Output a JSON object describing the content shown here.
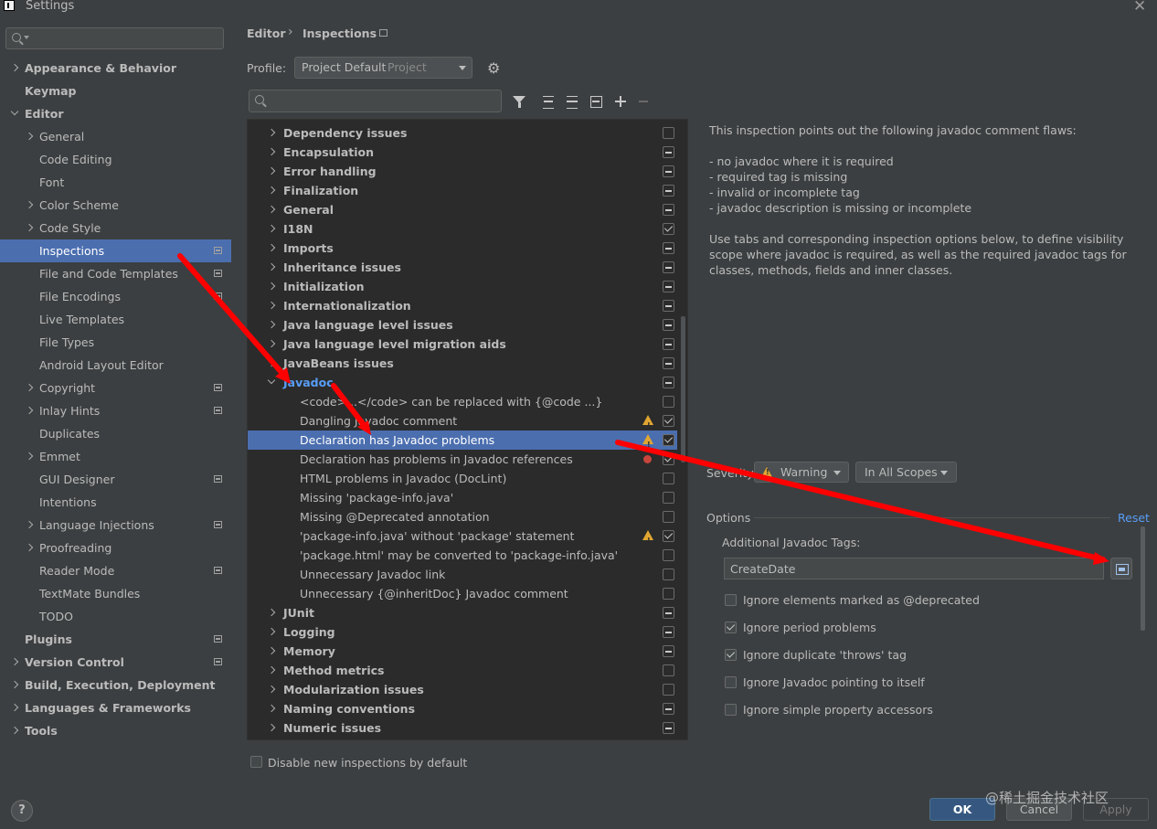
{
  "window": {
    "title": "Settings"
  },
  "sidebar": {
    "search_placeholder": "",
    "items": [
      {
        "label": "Appearance & Behavior"
      },
      {
        "label": "Keymap"
      },
      {
        "label": "Editor"
      },
      {
        "label": "General"
      },
      {
        "label": "Code Editing"
      },
      {
        "label": "Font"
      },
      {
        "label": "Color Scheme"
      },
      {
        "label": "Code Style"
      },
      {
        "label": "Inspections"
      },
      {
        "label": "File and Code Templates"
      },
      {
        "label": "File Encodings"
      },
      {
        "label": "Live Templates"
      },
      {
        "label": "File Types"
      },
      {
        "label": "Android Layout Editor"
      },
      {
        "label": "Copyright"
      },
      {
        "label": "Inlay Hints"
      },
      {
        "label": "Duplicates"
      },
      {
        "label": "Emmet"
      },
      {
        "label": "GUI Designer"
      },
      {
        "label": "Intentions"
      },
      {
        "label": "Language Injections"
      },
      {
        "label": "Proofreading"
      },
      {
        "label": "Reader Mode"
      },
      {
        "label": "TextMate Bundles"
      },
      {
        "label": "TODO"
      },
      {
        "label": "Plugins"
      },
      {
        "label": "Version Control"
      },
      {
        "label": "Build, Execution, Deployment"
      },
      {
        "label": "Languages & Frameworks"
      },
      {
        "label": "Tools"
      }
    ]
  },
  "breadcrumb": {
    "parent": "Editor",
    "separator": "›",
    "current": "Inspections"
  },
  "profile": {
    "label": "Profile:",
    "value": "Project Default",
    "scope": "Project"
  },
  "tree": {
    "search_placeholder": "",
    "rows": [
      {
        "label": "Dependency issues",
        "check": "off"
      },
      {
        "label": "Encapsulation",
        "check": "mixed"
      },
      {
        "label": "Error handling",
        "check": "mixed"
      },
      {
        "label": "Finalization",
        "check": "mixed"
      },
      {
        "label": "General",
        "check": "mixed"
      },
      {
        "label": "I18N",
        "check": "on"
      },
      {
        "label": "Imports",
        "check": "mixed"
      },
      {
        "label": "Inheritance issues",
        "check": "mixed"
      },
      {
        "label": "Initialization",
        "check": "mixed"
      },
      {
        "label": "Internationalization",
        "check": "mixed"
      },
      {
        "label": "Java language level issues",
        "check": "mixed"
      },
      {
        "label": "Java language level migration aids",
        "check": "mixed"
      },
      {
        "label": "JavaBeans issues",
        "check": "mixed"
      },
      {
        "label": "Javadoc",
        "check": "mixed"
      },
      {
        "label": "<code>...</code> can be replaced with {@code ...}",
        "check": "off"
      },
      {
        "label": "Dangling Javadoc comment",
        "check": "on",
        "severity": "warning"
      },
      {
        "label": "Declaration has Javadoc problems",
        "check": "on",
        "severity": "warning"
      },
      {
        "label": "Declaration has problems in Javadoc references",
        "check": "on",
        "severity": "error"
      },
      {
        "label": "HTML problems in Javadoc (DocLint)",
        "check": "off"
      },
      {
        "label": "Missing 'package-info.java'",
        "check": "off"
      },
      {
        "label": "Missing @Deprecated annotation",
        "check": "off"
      },
      {
        "label": "'package-info.java' without 'package' statement",
        "check": "on",
        "severity": "warning"
      },
      {
        "label": "'package.html' may be converted to 'package-info.java'",
        "check": "off"
      },
      {
        "label": "Unnecessary Javadoc link",
        "check": "off"
      },
      {
        "label": "Unnecessary {@inheritDoc} Javadoc comment",
        "check": "off"
      },
      {
        "label": "JUnit",
        "check": "mixed"
      },
      {
        "label": "Logging",
        "check": "mixed"
      },
      {
        "label": "Memory",
        "check": "mixed"
      },
      {
        "label": "Method metrics",
        "check": "off"
      },
      {
        "label": "Modularization issues",
        "check": "off"
      },
      {
        "label": "Naming conventions",
        "check": "mixed"
      },
      {
        "label": "Numeric issues",
        "check": "mixed"
      }
    ]
  },
  "disable_new": {
    "label": "Disable new inspections by default",
    "checked": false
  },
  "description": {
    "intro": "This inspection points out the following javadoc comment flaws:",
    "bullets": [
      "- no javadoc where it is required",
      "- required tag is missing",
      "- invalid or incomplete tag",
      "- javadoc description is missing or incomplete"
    ],
    "outro": "Use tabs and corresponding inspection options below, to define visibility scope where javadoc is required, as well as the required javadoc tags for classes, methods, fields and inner classes."
  },
  "severity": {
    "label": "Severity:",
    "value": "Warning",
    "scope": "In All Scopes"
  },
  "options": {
    "title": "Options",
    "reset": "Reset",
    "tags_label": "Additional Javadoc Tags:",
    "tags_value": "CreateDate",
    "checkboxes": [
      {
        "label": "Ignore elements marked as @deprecated",
        "checked": false
      },
      {
        "label": "Ignore period problems",
        "checked": true
      },
      {
        "label": "Ignore duplicate 'throws' tag",
        "checked": true
      },
      {
        "label": "Ignore Javadoc pointing to itself",
        "checked": false
      },
      {
        "label": "Ignore simple property accessors",
        "checked": false
      }
    ]
  },
  "footer": {
    "help": "?",
    "ok": "OK",
    "cancel": "Cancel",
    "apply": "Apply"
  },
  "watermark": "@稀土掘金技术社区",
  "colors": {
    "selection": "#4b6eaf",
    "link": "#589df6",
    "warning": "#e0a631",
    "annotation_arrow": "#ff0000"
  }
}
